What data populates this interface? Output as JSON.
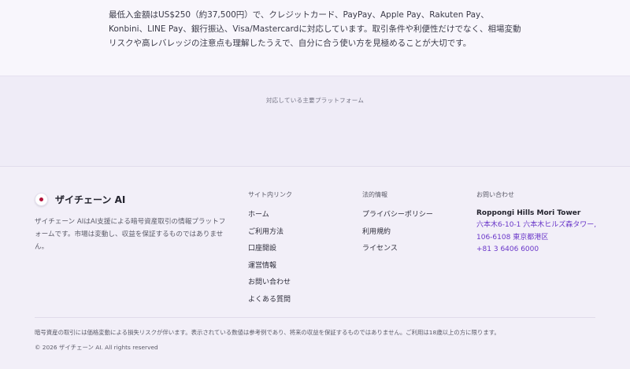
{
  "intro": {
    "text": "最低入金額はUS$250（約37,500円）で、クレジットカード、PayPay、Apple Pay、Rakuten Pay、Konbini、LINE Pay、銀行振込、Visa/Mastercardに対応しています。取引条件や利便性だけでなく、相場変動リスクや高レバレッジの注意点も理解したうえで、自分に合う使い方を見極めることが大切です。"
  },
  "platforms": {
    "label": "対応している主要プラットフォーム"
  },
  "footer": {
    "brand_name": "ザイチェーン AI",
    "brand_desc": "ザイチェーン AIはAI支援による暗号資産取引の情報プラットフォームです。市場は変動し、収益を保証するものではありません。",
    "site_links": {
      "title": "サイト内リンク",
      "items": [
        "ホーム",
        "ご利用方法",
        "口座開設",
        "運営情報",
        "お問い合わせ",
        "よくある質問"
      ]
    },
    "legal": {
      "title": "法的情報",
      "items": [
        "プライバシーポリシー",
        "利用規約",
        "ライセンス"
      ]
    },
    "contact": {
      "title": "お問い合わせ",
      "building": "Roppongi Hills Mori Tower",
      "address": "六本木6-10-1 六本木ヒルズ森タワー, 106-6108 東京都港区",
      "phone": "+81 3 6406 6000"
    },
    "disclaimer": "暗号資産の取引には価格変動による損失リスクが伴います。表示されている数値は参考例であり、将来の収益を保証するものではありません。ご利用は18歳以上の方に限ります。",
    "copyright": "© 2026 ザイチェーン AI. All rights reserved"
  }
}
